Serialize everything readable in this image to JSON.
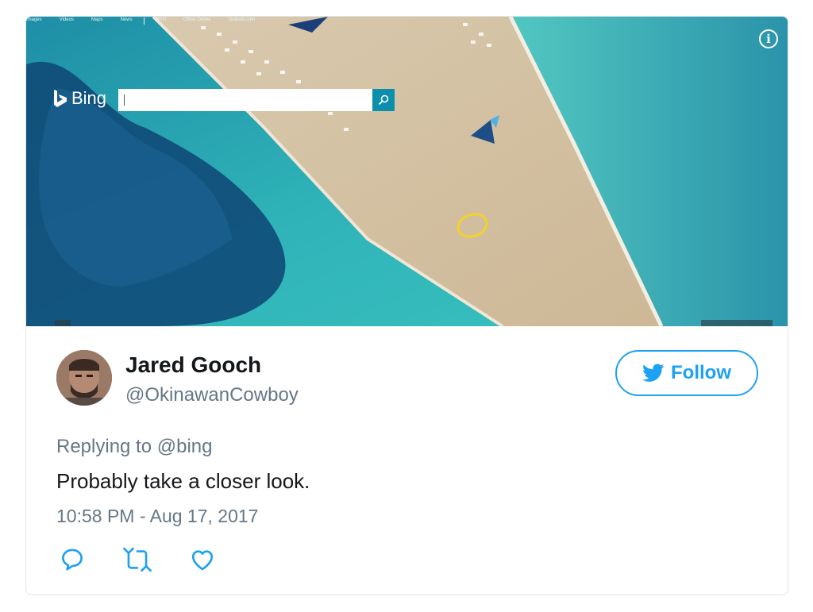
{
  "screenshot": {
    "nav_items": [
      "Images",
      "Videos",
      "Maps",
      "News",
      "MSN",
      "Office Online",
      "Outlook.com"
    ],
    "logo_text": "Bing",
    "search_value": "",
    "info_icon": "info-icon"
  },
  "tweet": {
    "author_name": "Jared Gooch",
    "author_handle": "@OkinawanCowboy",
    "follow_label": "Follow",
    "replying_prefix": "Replying to",
    "replying_mention": "@bing",
    "text": "Probably take a closer look.",
    "timestamp": "10:58 PM - Aug 17, 2017"
  },
  "colors": {
    "twitter_blue": "#1da1f2",
    "text_primary": "#14171a",
    "text_secondary": "#657786",
    "bing_accent": "#0c8ead",
    "highlight": "#f2d22a"
  },
  "icons": [
    "reply-icon",
    "retweet-icon",
    "like-icon",
    "twitter-bird-icon",
    "bing-logo-icon",
    "search-icon"
  ]
}
